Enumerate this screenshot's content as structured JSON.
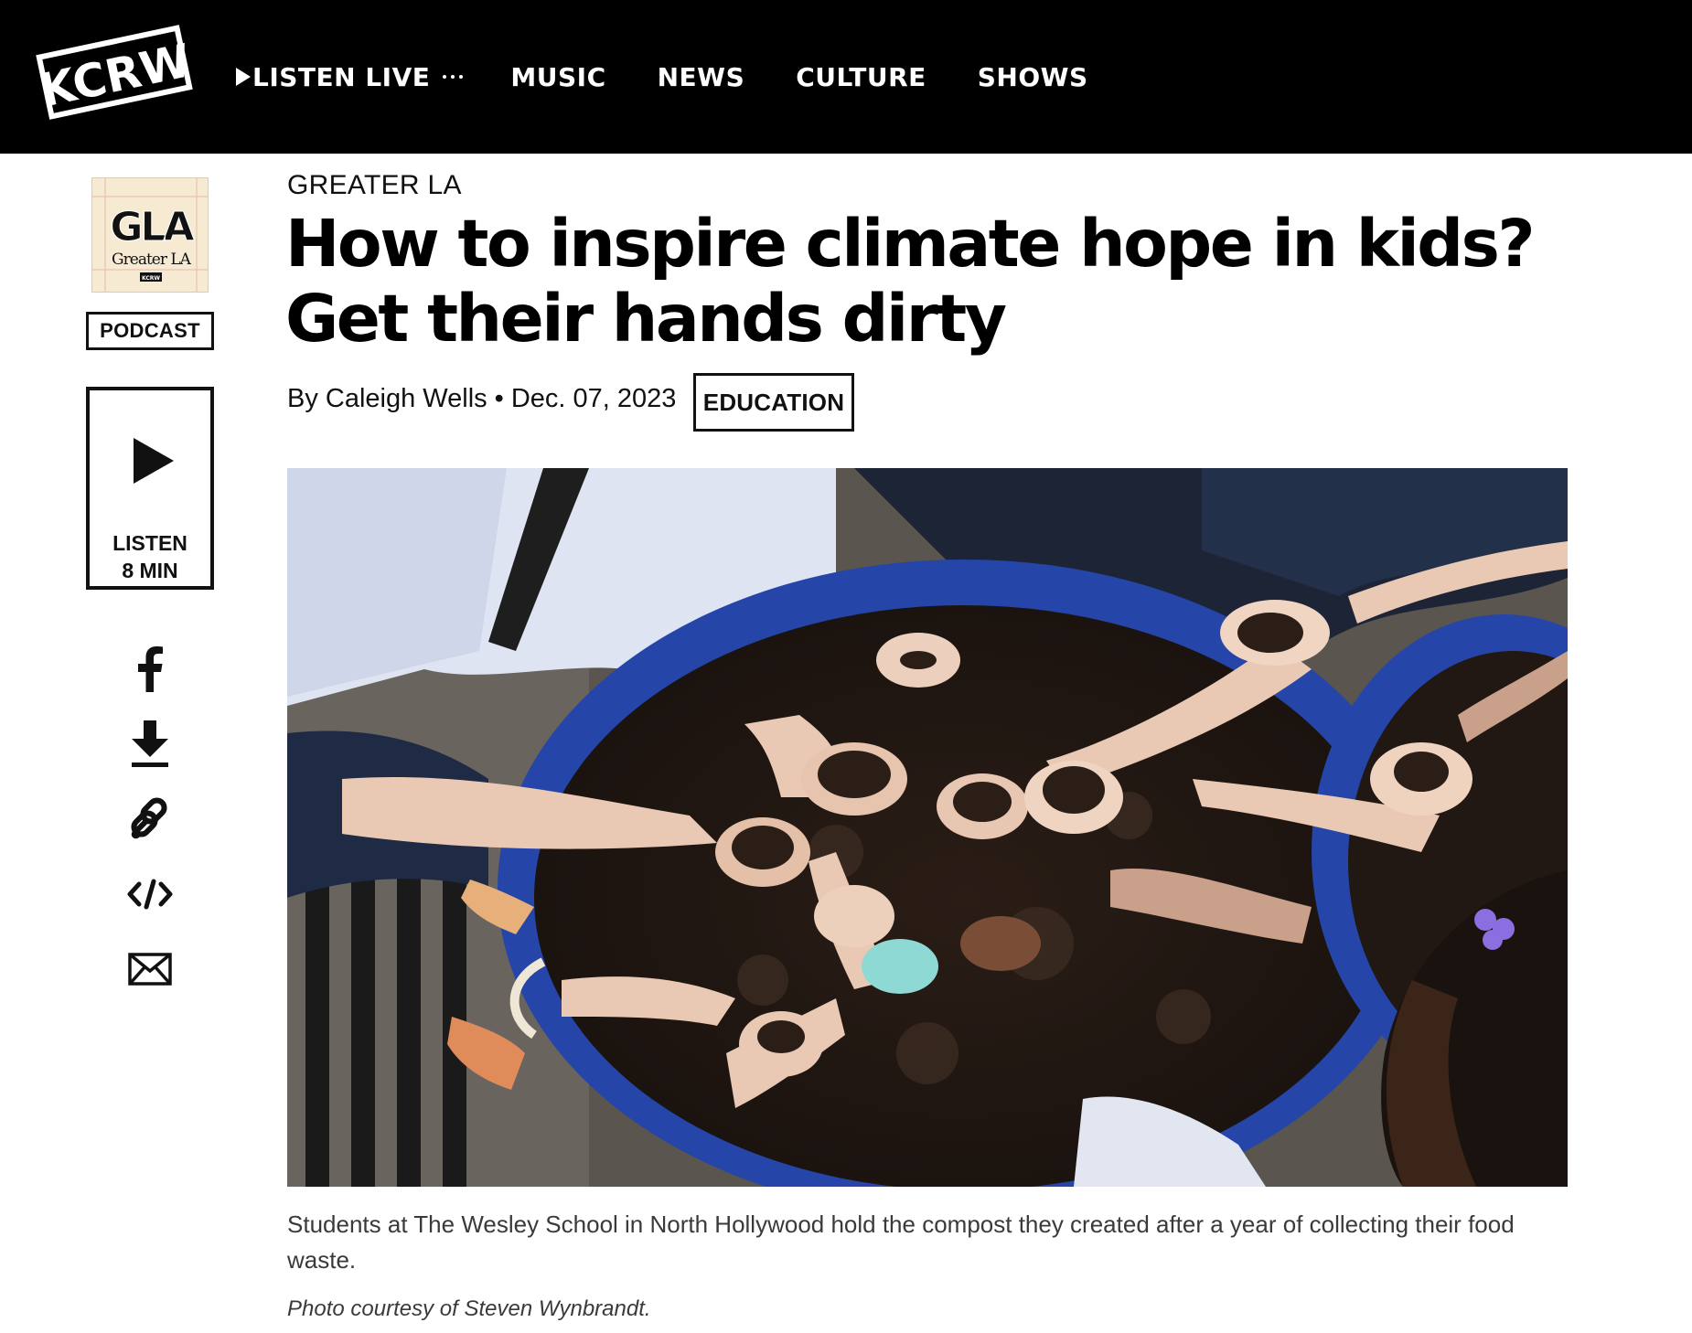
{
  "brand": {
    "logo_text": "KCRW",
    "colors": {
      "topbar": "#000000",
      "text": "#111111",
      "caption": "#3a3a3a"
    }
  },
  "nav": {
    "listen_live": "LISTEN LIVE",
    "items": [
      "MUSIC",
      "NEWS",
      "CULTURE",
      "SHOWS"
    ]
  },
  "sidebar": {
    "show_logo_text": "GLA",
    "show_logo_sub": "Greater LA",
    "show_logo_badge": "KCRW",
    "podcast_label": "PODCAST",
    "listen_label": "LISTEN",
    "listen_duration": "8 MIN",
    "share_icons": [
      "facebook-icon",
      "download-icon",
      "link-icon",
      "embed-icon",
      "email-icon"
    ]
  },
  "article": {
    "kicker": "GREATER LA",
    "headline": "How to inspire climate hope in kids? Get their hands dirty",
    "author": "By Caleigh Wells",
    "separator": "•",
    "date": "Dec. 07, 2023",
    "tag": "EDUCATION",
    "photo_alt": "Students at The Wesley School in North Hollywood hold the compost they created after a year of collecting their food waste.",
    "caption": "Students at The Wesley School in North Hollywood hold the compost they created after a year of collecting their food waste.",
    "credit": "Photo courtesy of Steven Wynbrandt."
  }
}
